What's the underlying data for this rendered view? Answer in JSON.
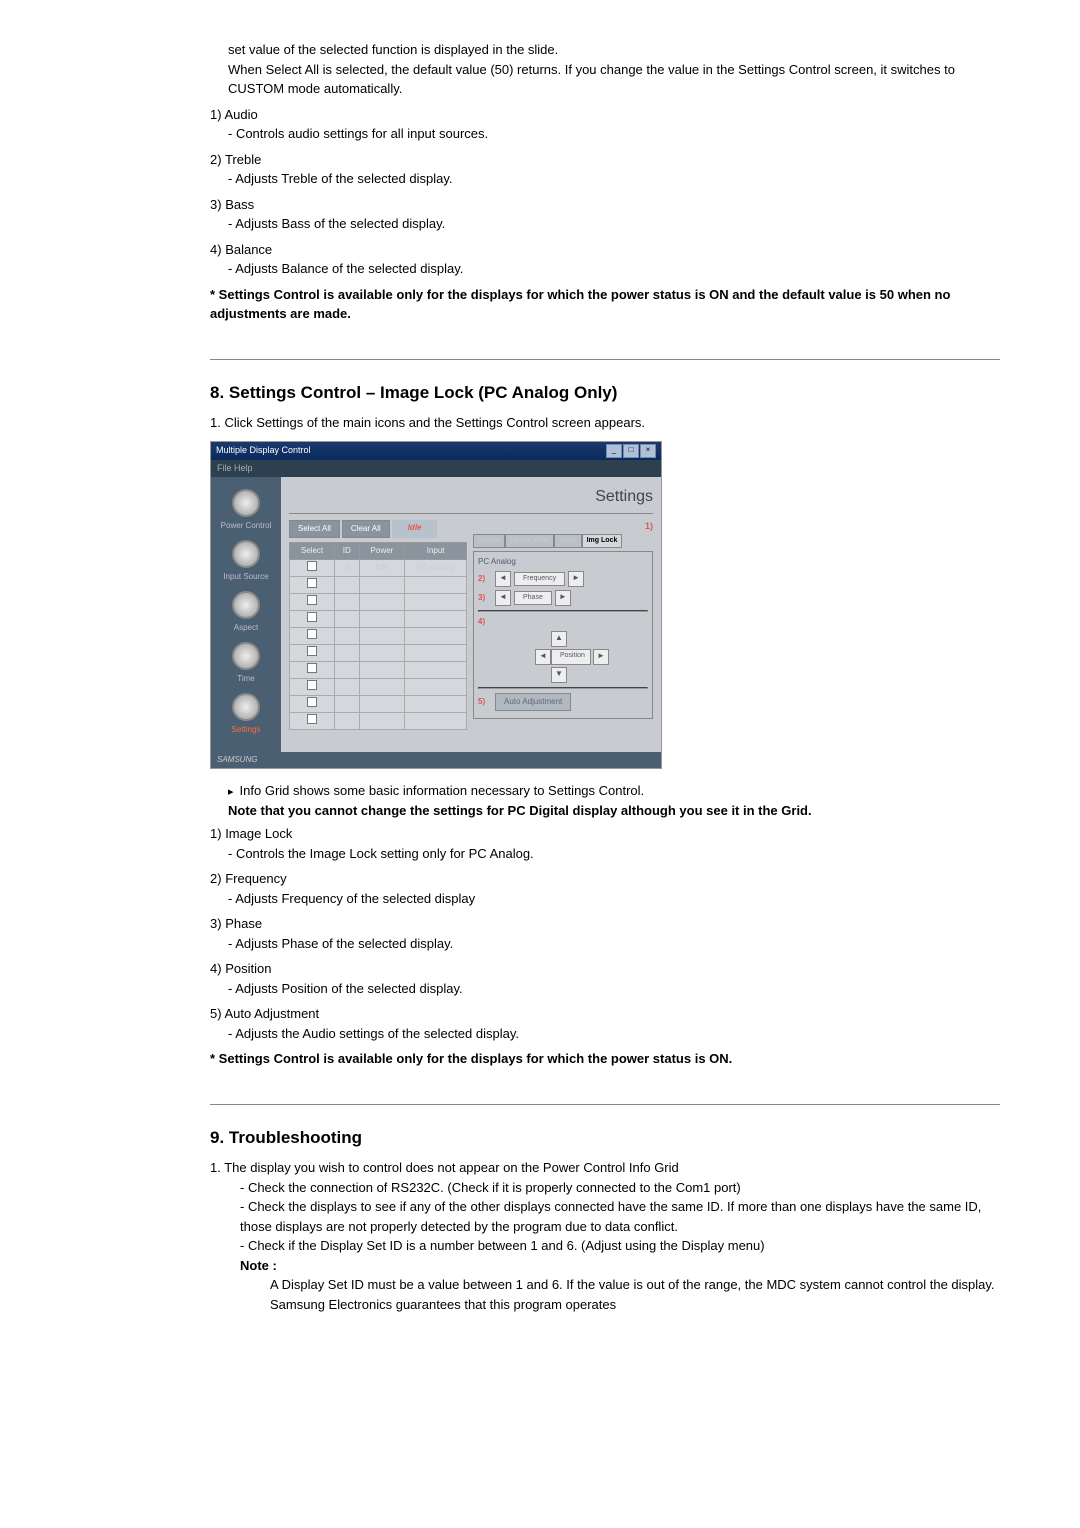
{
  "intro": {
    "line1": "set value of the selected function is displayed in the slide.",
    "line2": "When Select All is selected, the default value (50) returns. If you change the value in the Settings Control screen, it switches to CUSTOM mode automatically."
  },
  "audio_items": [
    {
      "num": "1)",
      "name": "Audio",
      "desc": "- Controls audio settings for all input sources."
    },
    {
      "num": "2)",
      "name": "Treble",
      "desc": "- Adjusts Treble of the selected display."
    },
    {
      "num": "3)",
      "name": "Bass",
      "desc": "- Adjusts Bass of the selected display."
    },
    {
      "num": "4)",
      "name": "Balance",
      "desc": "- Adjusts Balance of the selected display."
    }
  ],
  "audio_note": "*  Settings Control is available only for the displays for which the power status is ON and the default value is 50 when no adjustments are made.",
  "section8": {
    "title": "8. Settings Control – Image Lock (PC Analog Only)",
    "intro": "1.  Click Settings of the main icons and the Settings Control screen appears.",
    "bullet": "Info Grid shows some basic information necessary to Settings Control.",
    "bullet_bold": "Note that you cannot change the settings for PC Digital display although you see it in the Grid."
  },
  "screenshot": {
    "title": "Multiple Display Control",
    "menu": "File   Help",
    "header": "Settings",
    "nav": [
      "Power Control",
      "Input Source",
      "Aspect",
      "Time",
      "Settings"
    ],
    "buttons": {
      "select_all": "Select All",
      "clear_all": "Clear All",
      "idle": "Idle"
    },
    "cols": [
      "Select",
      "ID",
      "Power",
      "Input"
    ],
    "row": {
      "id": "2",
      "power": "ON",
      "input": "PC Analog"
    },
    "tabs": [
      "Picture",
      "Picture RGB",
      "Audio",
      "Img Lock"
    ],
    "panel_label": "PC Analog",
    "markers": {
      "m1": "1)",
      "m2": "2)",
      "m3": "3)",
      "m4": "4)",
      "m5": "5)"
    },
    "controls": {
      "freq": "Frequency",
      "phase": "Phase",
      "pos": "Position",
      "auto": "Auto Adjustment"
    },
    "brand": "SAMSUNG"
  },
  "lock_items": [
    {
      "num": "1)",
      "name": "Image Lock",
      "desc": "- Controls the Image Lock setting only for PC Analog."
    },
    {
      "num": "2)",
      "name": "Frequency",
      "desc": "- Adjusts Frequency of the selected display"
    },
    {
      "num": "3)",
      "name": "Phase",
      "desc": "- Adjusts Phase of the selected display."
    },
    {
      "num": "4)",
      "name": "Position",
      "desc": "- Adjusts Position of the selected display."
    },
    {
      "num": "5)",
      "name": "Auto Adjustment",
      "desc": "- Adjusts the Audio settings of the selected display."
    }
  ],
  "lock_note": "*  Settings Control is available only for the displays for which the power status is ON.",
  "section9": {
    "title": "9. Troubleshooting",
    "intro": "1.  The display you wish to control does not appear on the Power Control Info Grid",
    "checks": [
      "- Check the connection of RS232C. (Check if it is properly connected to the Com1 port)",
      "- Check the displays to see if any of the other displays connected have the same ID. If more than one displays have the same ID, those displays are not properly detected by the program due to data conflict.",
      "- Check if the Display Set ID is a number between 1 and 6. (Adjust using the Display menu)"
    ],
    "note_label": "Note :",
    "note_text": "A Display Set ID must be a value between 1 and 6. If the value is out of the range, the MDC system cannot control the display. Samsung Electronics guarantees that this program operates"
  }
}
